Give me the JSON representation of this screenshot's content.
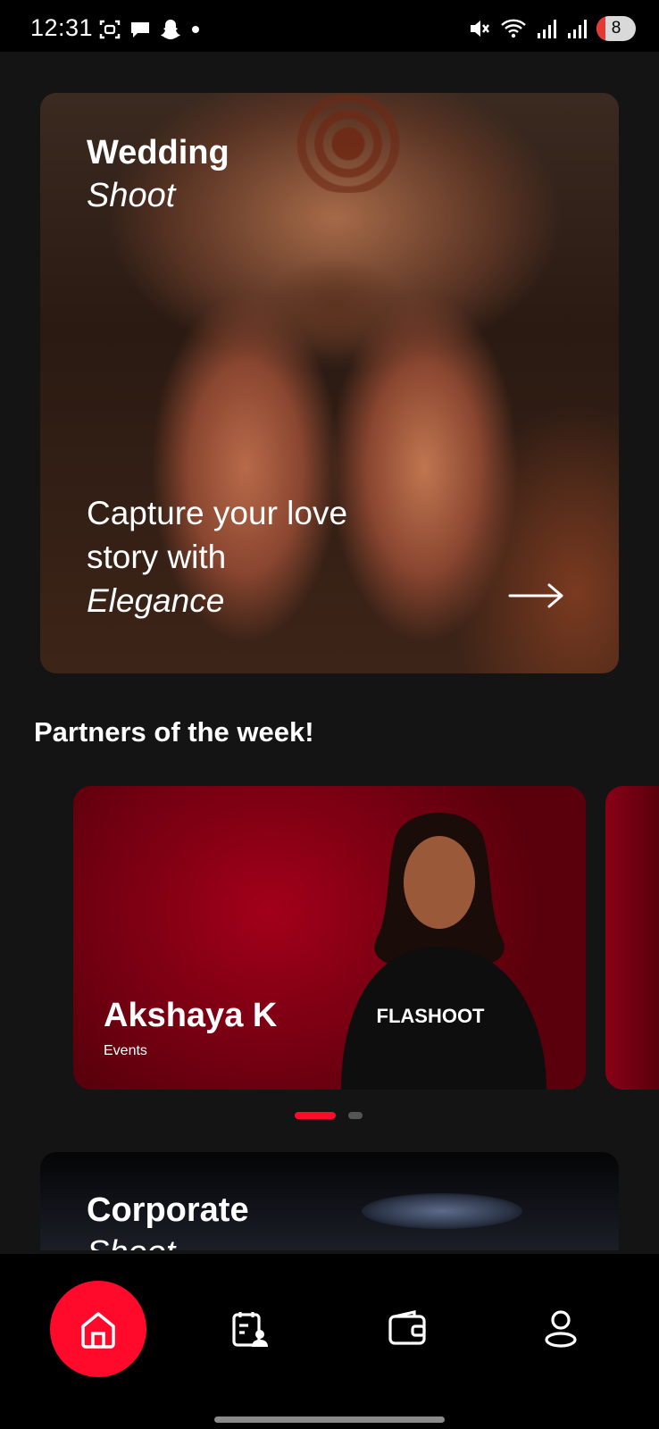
{
  "status_bar": {
    "time": "12:31",
    "battery": "8",
    "left_icons": [
      "screenshot-icon",
      "chat-icon",
      "snapchat-icon",
      "dot-icon"
    ],
    "right_icons": [
      "mute-icon",
      "wifi-icon",
      "signal-icon",
      "signal-icon"
    ]
  },
  "hero": {
    "title_line1": "Wedding",
    "title_line2": "Shoot",
    "tagline_part1": "Capture your love story with ",
    "tagline_emphasis": "Elegance",
    "arrow_icon": "arrow-right-icon"
  },
  "partners_section": {
    "title": "Partners of the week!",
    "cards": [
      {
        "name": "Akshaya K",
        "category": "Events",
        "shirt_brand": "FLASHOOT"
      }
    ],
    "pager": {
      "current": 1,
      "total": 2
    }
  },
  "corporate": {
    "title_line1": "Corporate",
    "title_line2": "Shoot"
  },
  "bottom_nav": {
    "items": [
      "home-icon",
      "bookings-icon",
      "wallet-icon",
      "profile-icon"
    ],
    "active": "home-icon"
  },
  "colors": {
    "accent": "#ff0a2a",
    "background": "#141414",
    "nav_background": "#000000"
  }
}
